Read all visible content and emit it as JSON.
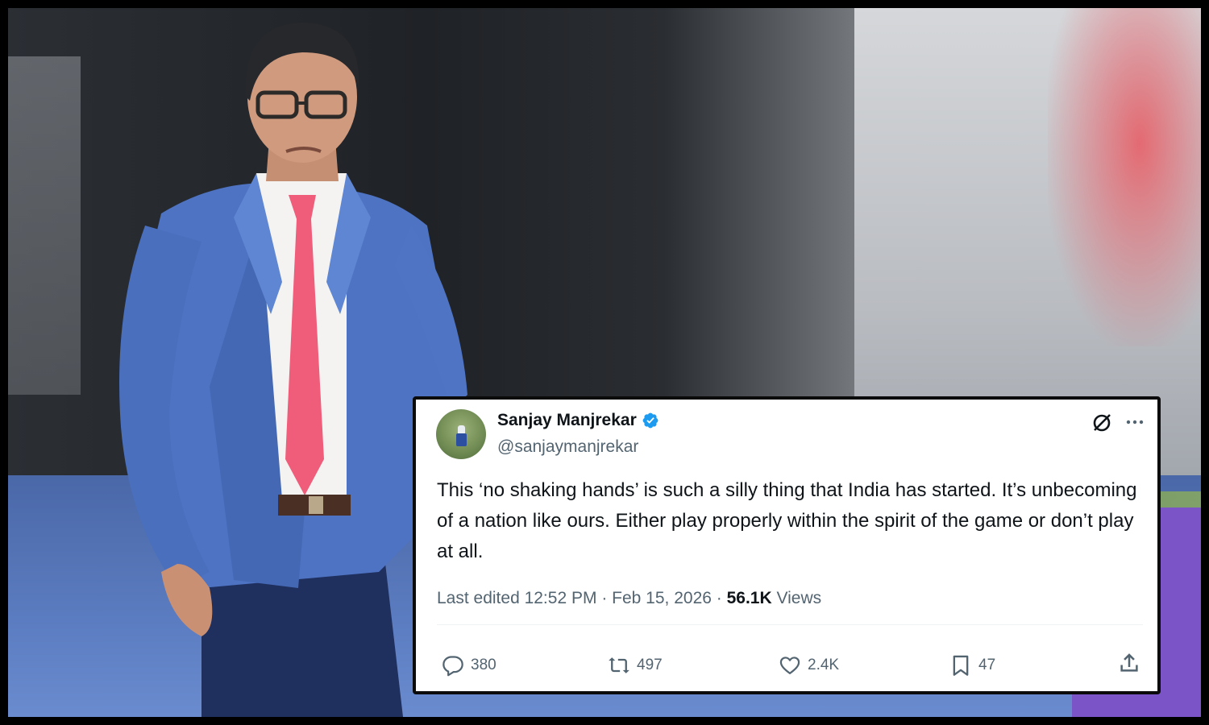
{
  "tweet": {
    "author_name": "Sanjay Manjrekar",
    "handle": "@sanjaymanjrekar",
    "text": "This ‘no shaking hands’ is such a silly thing that India has started. It’s unbecoming of a nation like ours. Either play properly within the spirit of the game or don’t play at all.",
    "edited_label": "Last edited 12:52 PM",
    "separator": "·",
    "date": "Feb 15, 2026",
    "views_count": "56.1K",
    "views_label": "Views",
    "replies": "380",
    "reposts": "497",
    "likes": "2.4K",
    "bookmarks": "47"
  },
  "icons": {
    "verified": "verified-badge-icon",
    "grok": "grok-icon",
    "more": "more-icon",
    "reply": "reply-icon",
    "repost": "repost-icon",
    "like": "heart-icon",
    "bookmark": "bookmark-icon",
    "share": "share-icon"
  },
  "colors": {
    "verified_blue": "#1d9bf0",
    "text_primary": "#0f1419",
    "text_secondary": "#536471",
    "card_border": "#0b0b0b"
  }
}
